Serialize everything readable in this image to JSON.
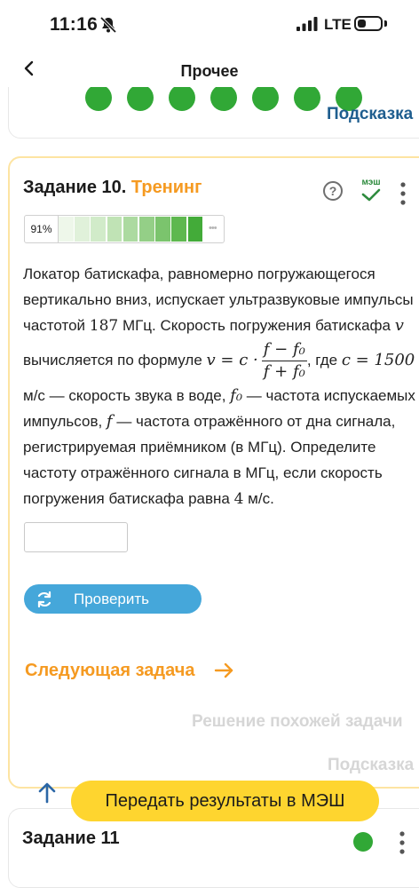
{
  "status_bar": {
    "time": "11:16",
    "network": "LTE",
    "icons": [
      "mute-icon",
      "signal-icon",
      "battery-icon"
    ]
  },
  "nav": {
    "title": "Прочее",
    "back_icon": "chevron-left-icon"
  },
  "prev_card": {
    "hint_label": "Подсказка",
    "dot_count": 7,
    "dot_color": "#31a836"
  },
  "task": {
    "title_label": "Задание 10.",
    "title_mode": "Тренинг",
    "help_label": "?",
    "mesh_badge": "мэш",
    "progress": {
      "percent_label": "91%",
      "value": 0.91,
      "segment_colors": [
        "#eef7ea",
        "#e0f1da",
        "#d1ebc9",
        "#c0e3b5",
        "#acdaa0",
        "#94cf87",
        "#7bc46d",
        "#5eb84f",
        "#43ab39"
      ]
    },
    "problem": {
      "p1": "Локатор батискафа, равномерно погружающегося вертикально вниз, испускает ультразвуковые импульсы частотой ",
      "freq": "187",
      "p2": " МГц. Скорость погружения батискафа ",
      "v": "v",
      "p3": " вычисляется по формуле ",
      "formula_lhs": "v = c ·",
      "formula_num": "f − f₀",
      "formula_den": "f + f₀",
      "p4": ", где ",
      "c_eq": "c = 1500",
      "p5": " м/с — скорость звука в воде, ",
      "f0": "f₀",
      "p6": " — частота испускаемых импульсов, ",
      "f": "f",
      "p7": " — частота отражённого от дна сигнала, регистрируемая приёмником (в МГц). Определите частоту отражённого сигнала в МГц, если скорость погружения батискафа равна ",
      "speed": "4",
      "p8": " м/с."
    },
    "answer": {
      "value": "",
      "placeholder": ""
    },
    "check_button_label": "Проверить",
    "next_task_label": "Следующая задача",
    "similar_solution_label": "Решение похожей задачи",
    "hint_label": "Подсказка"
  },
  "next_card": {
    "title": "Задание 11",
    "status_color": "#31a836"
  },
  "bottom": {
    "send_to_mesh_label": "Передать результаты в МЭШ"
  }
}
